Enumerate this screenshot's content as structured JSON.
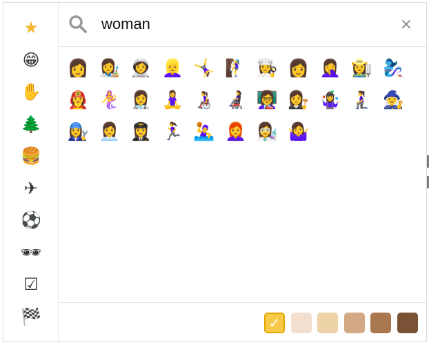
{
  "search": {
    "value": "woman",
    "clear_glyph": "×"
  },
  "sidebar": {
    "categories": [
      {
        "name": "star-icon",
        "glyph": "★"
      },
      {
        "name": "grinning-face-icon",
        "glyph": "😁"
      },
      {
        "name": "waving-hand-icon",
        "glyph": "✋"
      },
      {
        "name": "evergreen-tree-icon",
        "glyph": "🌲"
      },
      {
        "name": "hamburger-icon",
        "glyph": "🍔"
      },
      {
        "name": "airplane-icon",
        "glyph": "✈"
      },
      {
        "name": "soccer-ball-icon",
        "glyph": "⚽"
      },
      {
        "name": "sunglasses-icon",
        "glyph": "🕶"
      },
      {
        "name": "check-box-icon",
        "glyph": "☑"
      },
      {
        "name": "checkered-flag-icon",
        "glyph": "🏁"
      }
    ]
  },
  "results": [
    [
      "👩",
      "👩‍🎨",
      "👩‍🚀",
      "👱‍♀️",
      "🤸‍♀️",
      "🧗‍♀️",
      "👩‍🍳",
      "👩",
      "🤦‍♀️",
      "👩‍🌾",
      "🧞‍♀️"
    ],
    [
      "👩‍🚒",
      "🧜‍♀️",
      "👩‍⚕️",
      "🧘‍♀️",
      "👩‍🦽",
      "👩‍🦼",
      "👩‍🏫",
      "👩‍⚖️",
      "🤹‍♀️",
      "🧎‍♀️",
      "🧙‍♀️"
    ],
    [
      "👩‍🔧",
      "👩‍💼",
      "👩‍✈️",
      "🏃‍♀️",
      "🤽‍♀️",
      "👩‍🦰",
      "👩‍🔬",
      "🤷‍♀️"
    ]
  ],
  "skin_tones": {
    "colors": [
      "#f7c948",
      "#f3dfcf",
      "#ecd3a8",
      "#d2a885",
      "#a9784f",
      "#7a5236"
    ],
    "selected_index": 0,
    "check_glyph": "✓"
  }
}
